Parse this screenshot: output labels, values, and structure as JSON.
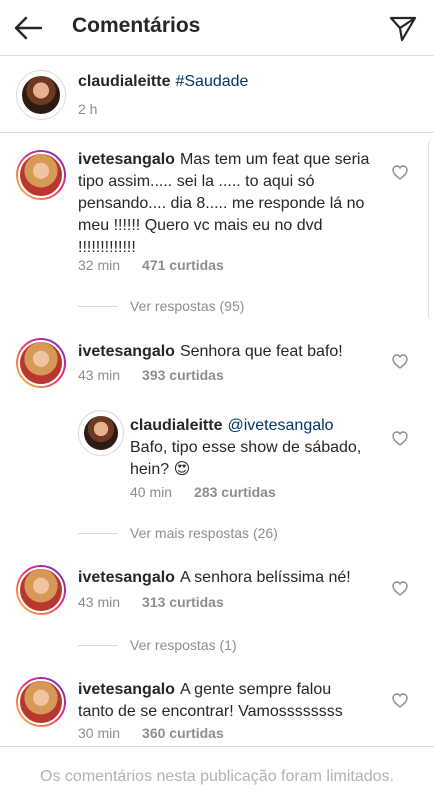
{
  "header": {
    "back_icon": "arrow-left-icon",
    "title": "Comentários",
    "send_icon": "paper-plane-icon"
  },
  "caption": {
    "username": "claudialeitte",
    "text": "#Saudade",
    "time": "2 h"
  },
  "comments": [
    {
      "username": "ivetesangalo",
      "text": "Mas tem um feat que seria tipo assim..... sei la ..... to aqui só pensando.... dia 8..... me responde lá no meu !!!!!! Quero vc mais eu no dvd !!!!!!!!!!!!!",
      "time": "32 min",
      "likes": "471 curtidas",
      "replies_link": "Ver respostas (95)"
    },
    {
      "username": "ivetesangalo",
      "text": "Senhora que feat bafo!",
      "time": "43 min",
      "likes": "393 curtidas",
      "reply": {
        "username": "claudialeitte",
        "mention": "@ivetesangalo",
        "text": "Bafo, tipo esse show de sábado, hein? 😍",
        "time": "40 min",
        "likes": "283 curtidas"
      },
      "replies_link": "Ver mais respostas (26)"
    },
    {
      "username": "ivetesangalo",
      "text": "A senhora belíssima né!",
      "time": "43 min",
      "likes": "313 curtidas",
      "replies_link": "Ver respostas (1)"
    },
    {
      "username": "ivetesangalo",
      "text": "A gente sempre falou tanto de se encontrar! Vamossssssss",
      "time": "30 min",
      "likes": "360 curtidas"
    }
  ],
  "footer": {
    "text": "Os comentários nesta publicação foram limitados."
  },
  "colors": {
    "text": "#262626",
    "secondary": "#8e8e8e",
    "hashtag": "#003569",
    "divider": "#dbdbdb"
  }
}
